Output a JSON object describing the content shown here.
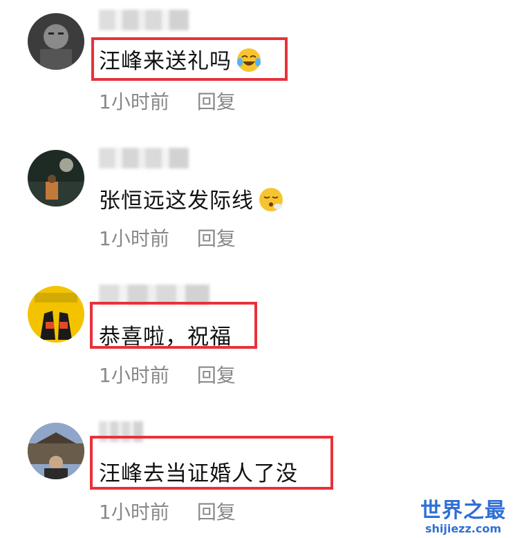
{
  "comments": [
    {
      "text": "汪峰来送礼吗",
      "time": "1小时前",
      "reply": "回复",
      "emoji": "laughing-crying-emoji"
    },
    {
      "text": "张恒远这发际线",
      "time": "1小时前",
      "reply": "回复",
      "emoji": "sighing-emoji"
    },
    {
      "text": "恭喜啦，祝福",
      "time": "1小时前",
      "reply": "回复"
    },
    {
      "text": "汪峰去当证婚人了没",
      "time": "1小时前",
      "reply": "回复"
    }
  ],
  "watermark": {
    "title": "世界之最",
    "url": "shijiezz.com"
  },
  "colors": {
    "highlight": "#e8313b",
    "meta": "#888888",
    "watermark": "#2f6fd6"
  }
}
